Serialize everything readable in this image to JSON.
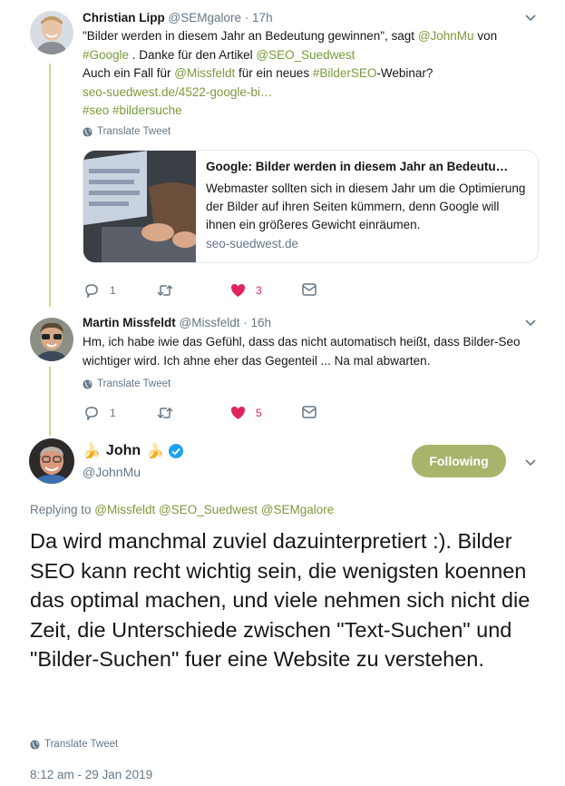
{
  "colors": {
    "accent": "#7a9a3a",
    "thread_line": "#c8d59b",
    "like": "#e0245e",
    "follow_button": "#a7b46b",
    "verified": "#1da1f2"
  },
  "tweet1": {
    "author_name": "Christian Lipp",
    "handle": "@SEMgalore",
    "time": "17h",
    "line1": "\"Bilder werden in diesem Jahr an Bedeutung gewinnen\", sagt ",
    "mention_johnmu": "@JohnMu",
    "line1_end": " von",
    "hashtag_google": "#Google",
    "line2_mid": " . Danke für den Artikel ",
    "mention_seo_suedwest": "@SEO_Suedwest",
    "line3_start": "Auch ein Fall für ",
    "mention_missfeldt": "@Missfeldt",
    "line3_mid": " für ein neues ",
    "hashtag_bilderseo": "#BilderSEO",
    "line3_end": "-Webinar?",
    "url": "seo-suedwest.de/4522-google-bi…",
    "hashtag_seo": "#seo",
    "hashtag_bildersuche": "#bildersuche",
    "translate": "Translate Tweet",
    "card": {
      "title": "Google: Bilder werden in diesem Jahr an Bedeutu…",
      "description": "Webmaster sollten sich in diesem Jahr um die Optimierung der Bilder auf ihren Seiten kümmern, denn Google will ihnen ein größeres Gewicht einräumen.",
      "domain": "seo-suedwest.de"
    },
    "reply_count": "1",
    "retweet_count": "",
    "like_count": "3"
  },
  "tweet2": {
    "author_name": "Martin Missfeldt",
    "handle": "@Missfeldt",
    "time": "16h",
    "text": "Hm, ich habe iwie das Gefühl, dass das nicht automatisch heißt, dass Bilder-Seo wichtiger wird. Ich ahne eher das Gegenteil ... Na mal abwarten.",
    "translate": "Translate Tweet",
    "reply_count": "1",
    "like_count": "5"
  },
  "main_tweet": {
    "author_name": "John",
    "emoji_left": "🍌",
    "emoji_right": "🍌",
    "handle": "@JohnMu",
    "follow_label": "Following",
    "replying_prefix": "Replying to ",
    "replying_handles": "@Missfeldt @SEO_Suedwest @SEMgalore",
    "text": "Da wird manchmal zuviel dazuinterpretiert :). Bilder SEO kann recht wichtig sein, die wenigsten koennen das optimal machen, und viele nehmen sich nicht die Zeit, die Unterschiede zwischen \"Text-Suchen\" und \"Bilder-Suchen\" fuer eine Website zu verstehen.",
    "translate": "Translate Tweet",
    "timestamp": "8:12 am - 29 Jan 2019"
  },
  "icons": [
    "chevron-down-icon",
    "globe-icon",
    "reply-icon",
    "retweet-icon",
    "heart-icon",
    "mail-icon",
    "verified-icon"
  ]
}
